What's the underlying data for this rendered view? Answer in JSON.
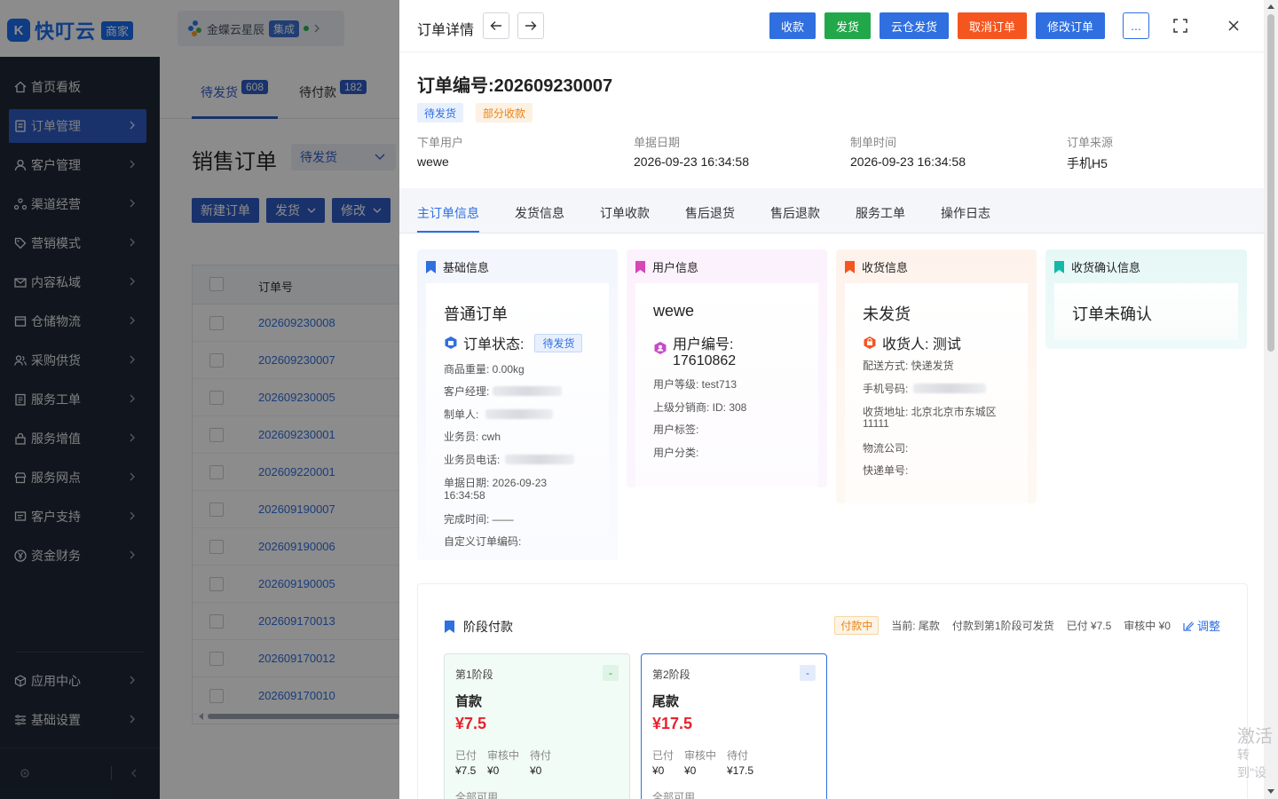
{
  "brand": {
    "name": "快叮云",
    "tag": "商家"
  },
  "integration": {
    "name": "金蝶云星辰",
    "badge": "集成"
  },
  "sidebar": {
    "items": [
      {
        "label": "首页看板",
        "icon": "home-icon",
        "active": false
      },
      {
        "label": "订单管理",
        "icon": "document-icon",
        "active": true
      },
      {
        "label": "客户管理",
        "icon": "user-icon",
        "active": false
      },
      {
        "label": "渠道经营",
        "icon": "share-icon",
        "active": false
      },
      {
        "label": "营销模式",
        "icon": "tag-icon",
        "active": false
      },
      {
        "label": "内容私域",
        "icon": "mail-icon",
        "active": false
      },
      {
        "label": "仓储物流",
        "icon": "box-icon",
        "active": false
      },
      {
        "label": "采购供货",
        "icon": "user-group-icon",
        "active": false
      },
      {
        "label": "服务工单",
        "icon": "clipboard-icon",
        "active": false
      },
      {
        "label": "服务增值",
        "icon": "lock-icon",
        "active": false
      },
      {
        "label": "服务网点",
        "icon": "store-icon",
        "active": false
      },
      {
        "label": "客户支持",
        "icon": "support-icon",
        "active": false
      },
      {
        "label": "资金财务",
        "icon": "yen-icon",
        "active": false
      }
    ],
    "bottom": [
      {
        "label": "应用中心",
        "icon": "cube-icon"
      },
      {
        "label": "基础设置",
        "icon": "settings-list-icon"
      }
    ]
  },
  "list": {
    "tabs": [
      {
        "label": "待发货",
        "count": "608"
      },
      {
        "label": "待付款",
        "count": "182"
      }
    ],
    "title": "销售订单",
    "status_filter": "待发货",
    "buttons": [
      "新建订单",
      "发货",
      "修改"
    ],
    "column_header": "订单号",
    "orders": [
      "202609230008",
      "202609230007",
      "202609230005",
      "202609230001",
      "202609220001",
      "202609190007",
      "202609190006",
      "202609190005",
      "202609170013",
      "202609170012",
      "202609170010"
    ]
  },
  "drawer": {
    "title": "订单详情",
    "actions": [
      {
        "label": "收款",
        "color": "#2f6fe0"
      },
      {
        "label": "发货",
        "color": "#22a84a"
      },
      {
        "label": "云仓发货",
        "color": "#2f6fe0"
      },
      {
        "label": "取消订单",
        "color": "#f5551f"
      },
      {
        "label": "修改订单",
        "color": "#2f6fe0"
      }
    ],
    "more_label": "...",
    "order_no_label": "订单编号:",
    "order_no": "202609230007",
    "tags": [
      "待发货",
      "部分收款"
    ],
    "meta": [
      {
        "label": "下单用户",
        "value": "wewe"
      },
      {
        "label": "单据日期",
        "value": "2026-09-23 16:34:58"
      },
      {
        "label": "制单时间",
        "value": "2026-09-23 16:34:58"
      },
      {
        "label": "订单来源",
        "value": "手机H5"
      }
    ],
    "tabs": [
      "主订单信息",
      "发货信息",
      "订单收款",
      "售后退货",
      "售后退款",
      "服务工单",
      "操作日志"
    ]
  },
  "cards": {
    "basic": {
      "title": "基础信息",
      "type": "普通订单",
      "status_label": "订单状态:",
      "status": "待发货",
      "weight": "商品重量: 0.00kg",
      "manager_label": "客户经理:",
      "creator_label": "制单人:",
      "salesman": "业务员: cwh",
      "salesman_phone_label": "业务员电话:",
      "date_label": "单据日期: 2026-09-23",
      "date_time": "16:34:58",
      "done_time": "完成时间: ——",
      "custom_code": "自定义订单编码:"
    },
    "user": {
      "title": "用户信息",
      "name": "wewe",
      "id_label": "用户编号:",
      "id": "17610862",
      "level": "用户等级: test713",
      "parent": "上级分销商: ID: 308",
      "tags": "用户标签:",
      "category": "用户分类:"
    },
    "shipping": {
      "title": "收货信息",
      "state": "未发货",
      "receiver": "收货人: 测试",
      "method": "配送方式: 快递发货",
      "phone_label": "手机号码:",
      "address": "收货地址: 北京北京市东城区",
      "address2": "11111",
      "company": "物流公司:",
      "tracking": "快递单号:"
    },
    "confirm": {
      "title": "收货确认信息",
      "state": "订单未确认"
    }
  },
  "stages": {
    "title": "阶段付款",
    "status": "付款中",
    "current": "当前: 尾款",
    "rule": "付款到第1阶段可发货",
    "paid": "已付 ¥7.5",
    "reviewing": "审核中 ¥0",
    "adjust": "调整",
    "items": [
      {
        "label": "第1阶段",
        "name": "首款",
        "amount": "¥7.5",
        "k1": "已付",
        "k2": "审核中",
        "k3": "待付",
        "v1": "¥7.5",
        "v2": "¥0",
        "v3": "¥0",
        "all": "全部可用"
      },
      {
        "label": "第2阶段",
        "name": "尾款",
        "amount": "¥17.5",
        "k1": "已付",
        "k2": "审核中",
        "k3": "待付",
        "v1": "¥0",
        "v2": "¥0",
        "v3": "¥17.5",
        "all": "全部可用"
      }
    ]
  },
  "watermark": {
    "line1": "激活",
    "line2": "转到\"设"
  }
}
